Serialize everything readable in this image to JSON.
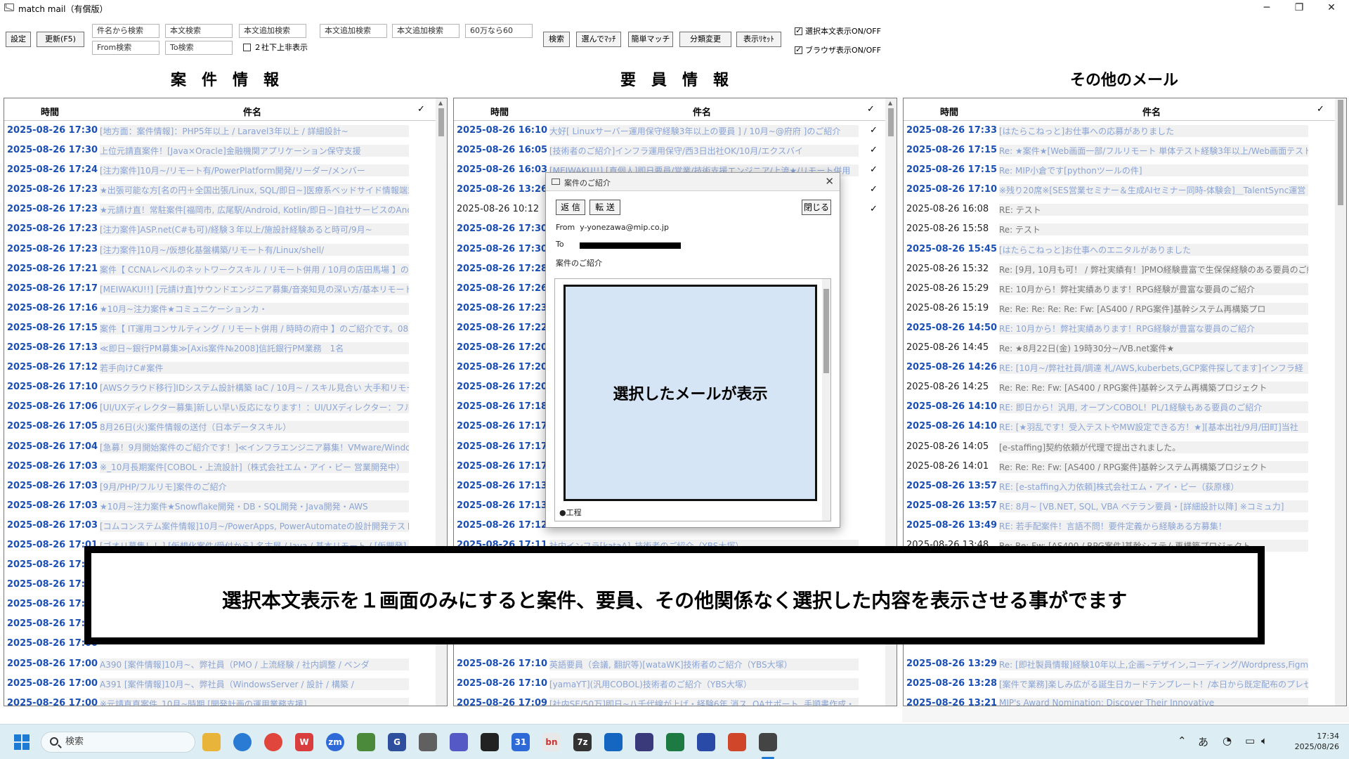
{
  "window": {
    "title": "match mail（有償版）"
  },
  "toolbar": {
    "settings": "設定",
    "refresh": "更新(F5)",
    "subject_search": "件名から検索",
    "from_search": "From検索",
    "body_search": "本文検索",
    "to_search": "To検索",
    "body_add_search_1": "本文追加検索",
    "body_add_search_2": "本文追加検索",
    "body_add_search_3": "本文追加検索",
    "amount_field": "60万なら60",
    "below2_label": "２社下上非表示",
    "search_btn": "検索",
    "pick_match": "選んでﾏｯﾁ",
    "easy_match": "簡単マッチ",
    "classify_change": "分類変更",
    "display_reset": "表示ﾘｾｯﾄ",
    "body_display_toggle": "選択本文表示ON/OFF",
    "browser_display_toggle": "ブラウザ表示ON/OFF"
  },
  "headings": {
    "projects": "案　件　情　報",
    "personnel": "要　員　情　報",
    "other": "その他のメール"
  },
  "columns": {
    "time": "時間",
    "subject": "件名",
    "check": "✓"
  },
  "panels": {
    "projects": [
      {
        "time": "2025-08-26 17:30",
        "subject": "[地方面：案件情報]：PHP5年以上 / Laravel3年以上 / 詳細設計~",
        "read": false,
        "check": ""
      },
      {
        "time": "2025-08-26 17:30",
        "subject": "上位元請直案件！[Java×Oracle]金融機関アプリケーション保守支援",
        "read": false,
        "check": ""
      },
      {
        "time": "2025-08-26 17:24",
        "subject": "[注力案件]10月~/リモート有/PowerPlatform開発/リーダー/メンバー",
        "read": false,
        "check": ""
      },
      {
        "time": "2025-08-26 17:23",
        "subject": "★出張可能な方[名の円＋全国出張/Linux, SQL/即日~]医療系ベッドサイド情報端末",
        "read": false,
        "check": ""
      },
      {
        "time": "2025-08-26 17:23",
        "subject": "★元請け直！常駐案件[福岡市, 広尾駅/Android, Kotlin/即日~]自社サービスのAndroid",
        "read": false,
        "check": ""
      },
      {
        "time": "2025-08-26 17:23",
        "subject": "[注力案件]ASP.net(C#も可)/経験３年以上/施設計経験あると時可/9月~",
        "read": false,
        "check": ""
      },
      {
        "time": "2025-08-26 17:23",
        "subject": "[注力案件]10月~/仮想化基盤構築/リモート有/Linux/shell/",
        "read": false,
        "check": ""
      },
      {
        "time": "2025-08-26 17:21",
        "subject": "案件【 CCNAレベルのネットワークスキル / リモート併用 / 10月の店田馬場 】のご紹介",
        "read": false,
        "check": ""
      },
      {
        "time": "2025-08-26 17:17",
        "subject": "[MEIWAKU!!] [元請け直]サウンドエンジニア募集/音楽知見の深い方/基本リモート (",
        "read": false,
        "check": ""
      },
      {
        "time": "2025-08-26 17:16",
        "subject": "★10月~注力案件★コミュニケーションカ・",
        "read": false,
        "check": ""
      },
      {
        "time": "2025-08-26 17:15",
        "subject": "案件【 IT運用コンサルティング / リモート併用 / 時時の府中 】のご紹介です。0826",
        "read": false,
        "check": ""
      },
      {
        "time": "2025-08-26 17:13",
        "subject": "≪即日~銀行PM募集≫[Axis案件№2008]信託銀行PM業務　1名",
        "read": false,
        "check": ""
      },
      {
        "time": "2025-08-26 17:12",
        "subject": "若手向けC#案件",
        "read": false,
        "check": ""
      },
      {
        "time": "2025-08-26 17:10",
        "subject": "[AWSクラウド移行]IDシステム設計構築 IaC / 10月~ / スキル見合い 大手和リモート",
        "read": false,
        "check": ""
      },
      {
        "time": "2025-08-26 17:06",
        "subject": "[UI/UXディレクター募集]新しい早い反応になります！：UI/UXディレクター：フルリモート",
        "read": false,
        "check": ""
      },
      {
        "time": "2025-08-26 17:05",
        "subject": "8月26日(火)案件情報の送付（日本データスキル）",
        "read": false,
        "check": ""
      },
      {
        "time": "2025-08-26 17:04",
        "subject": "[急募！9月開始案件のご紹介です！]≪インフラエンジニア募集！VMware/Windows",
        "read": false,
        "check": ""
      },
      {
        "time": "2025-08-26 17:03",
        "subject": "※_10月長期案件[COBOL・上流設計]（株式会社エム・アイ・ピー 営業開発中）",
        "read": false,
        "check": ""
      },
      {
        "time": "2025-08-26 17:03",
        "subject": "[9月/PHP/フルリモ]案件のご紹介",
        "read": false,
        "check": ""
      },
      {
        "time": "2025-08-26 17:03",
        "subject": "★10月~注力案件★Snowflake開発・DB・SQL開発・Java開発・AWS",
        "read": false,
        "check": ""
      },
      {
        "time": "2025-08-26 17:03",
        "subject": "[コムコンステム案件情報]10月~/PowerApps, PowerAutomateの設計開発テスト",
        "read": false,
        "check": ""
      },
      {
        "time": "2025-08-26 17:01",
        "subject": "[ゴオリ募集！！] [仮想化案件/受付から] 名古屋 / Java / 基本リモート / [仮開発]",
        "read": false,
        "check": ""
      },
      {
        "time": "2025-08-26 17:00",
        "subject": "",
        "read": false,
        "check": ""
      },
      {
        "time": "2025-08-26 17:00",
        "subject": "",
        "read": false,
        "check": ""
      },
      {
        "time": "2025-08-26 17:00",
        "subject": "",
        "read": false,
        "check": ""
      },
      {
        "time": "2025-08-26 17:00",
        "subject": "",
        "read": false,
        "check": ""
      },
      {
        "time": "2025-08-26 17:00",
        "subject": "",
        "read": false,
        "check": ""
      },
      {
        "time": "2025-08-26 17:00",
        "subject": "A390 [案件情報]10月~、弊社員（PMO / 上流経験 / 社内調整 / ベンダ",
        "read": false,
        "check": ""
      },
      {
        "time": "2025-08-26 17:00",
        "subject": "A391 [案件情報]10月~、弊社員（WindowsServer / 設計 / 構築 /",
        "read": false,
        "check": ""
      },
      {
        "time": "2025-08-26 17:00",
        "subject": "※元請直直案件_10月~時期 [開発計画の運用業務支援]",
        "read": false,
        "check": ""
      }
    ],
    "personnel": [
      {
        "time": "2025-08-26 16:10",
        "subject": "大好[ Linuxサーバー運用保守経験3年以上の要員 ] / 10月~@府府 ]のご紹介",
        "read": false,
        "check": "✓"
      },
      {
        "time": "2025-08-26 16:05",
        "subject": "[技術者のご紹介]インフラ運用保守/西3日出社OK/10月/エクスバイ",
        "read": false,
        "check": "✓"
      },
      {
        "time": "2025-08-26 16:03",
        "subject": "[MEIWAKU!!] [直個人]即日要員/営業/技術支援エンジニア/上流★/リモート併用",
        "read": false,
        "check": "✓"
      },
      {
        "time": "2025-08-26 13:26",
        "subject": "",
        "read": false,
        "check": "✓"
      },
      {
        "time": "2025-08-26 10:12",
        "subject": "",
        "read": true,
        "check": "✓"
      },
      {
        "time": "2025-08-26 17:30",
        "subject": "",
        "read": false,
        "check": ""
      },
      {
        "time": "2025-08-26 17:30",
        "subject": "",
        "read": false,
        "check": ""
      },
      {
        "time": "2025-08-26 17:28",
        "subject": "",
        "read": false,
        "check": ""
      },
      {
        "time": "2025-08-26 17:26",
        "subject": "",
        "read": false,
        "check": ""
      },
      {
        "time": "2025-08-26 17:23",
        "subject": "",
        "read": false,
        "check": ""
      },
      {
        "time": "2025-08-26 17:22",
        "subject": "",
        "read": false,
        "check": ""
      },
      {
        "time": "2025-08-26 17:20",
        "subject": "",
        "read": false,
        "check": ""
      },
      {
        "time": "2025-08-26 17:20",
        "subject": "",
        "read": false,
        "check": ""
      },
      {
        "time": "2025-08-26 17:20",
        "subject": "",
        "read": false,
        "check": ""
      },
      {
        "time": "2025-08-26 17:18",
        "subject": "",
        "read": false,
        "check": ""
      },
      {
        "time": "2025-08-26 17:17",
        "subject": "",
        "read": false,
        "check": ""
      },
      {
        "time": "2025-08-26 17:17",
        "subject": "",
        "read": false,
        "check": ""
      },
      {
        "time": "2025-08-26 17:17",
        "subject": "",
        "read": false,
        "check": ""
      },
      {
        "time": "2025-08-26 17:13",
        "subject": "",
        "read": false,
        "check": ""
      },
      {
        "time": "2025-08-26 17:13",
        "subject": "",
        "read": false,
        "check": ""
      },
      {
        "time": "2025-08-26 17:12",
        "subject": "",
        "read": false,
        "check": ""
      },
      {
        "time": "2025-08-26 17:11",
        "subject": "社内インフラ[kataA]_技術者のご紹介（YBS大塚）",
        "read": false,
        "check": ""
      },
      {
        "time": "",
        "subject": "",
        "read": false,
        "check": ""
      },
      {
        "time": "",
        "subject": "",
        "read": false,
        "check": ""
      },
      {
        "time": "",
        "subject": "",
        "read": false,
        "check": ""
      },
      {
        "time": "",
        "subject": "",
        "read": false,
        "check": ""
      },
      {
        "time": "",
        "subject": "",
        "read": false,
        "check": ""
      },
      {
        "time": "2025-08-26 17:10",
        "subject": "英語要員（会議, 翻訳等)[wataWK]技術者のご紹介（YBS大塚）",
        "read": false,
        "check": ""
      },
      {
        "time": "2025-08-26 17:10",
        "subject": "[yamaYT](汎用COBOL)技術者のご紹介（YBS大塚）",
        "read": false,
        "check": ""
      },
      {
        "time": "2025-08-26 17:09",
        "subject": "[社内SE/50万]即日~八千代線が上げ・経験6年 消ス, OAサポート, 手順書作成・",
        "read": false,
        "check": ""
      }
    ],
    "other": [
      {
        "time": "2025-08-26 17:33",
        "subject": "[はたらこねっと]お仕事への応募がありました",
        "read": false,
        "check": ""
      },
      {
        "time": "2025-08-26 17:15",
        "subject": "Re: ★案件★[Web画面一部/フルリモート 単体テスト経験3年以上/Web画面テスト経",
        "read": false,
        "check": ""
      },
      {
        "time": "2025-08-26 17:15",
        "subject": "Re: MIP小倉です[pythonツールの件]",
        "read": false,
        "check": ""
      },
      {
        "time": "2025-08-26 17:10",
        "subject": "※残り20席※[SES営業セミナー＆生成AIセミナー同時-体験会]＿TalentSync運営",
        "read": false,
        "check": ""
      },
      {
        "time": "2025-08-26 16:08",
        "subject": "RE: テスト",
        "read": true,
        "check": ""
      },
      {
        "time": "2025-08-26 15:58",
        "subject": "Re: テスト",
        "read": true,
        "check": ""
      },
      {
        "time": "2025-08-26 15:45",
        "subject": "[はたらこねっと]お仕事へのエニタルがありました",
        "read": false,
        "check": ""
      },
      {
        "time": "2025-08-26 15:32",
        "subject": "Re: [9月, 10月も可！ / 弊社実績有！]PMO経験豊富で生保保経験のある要員のご紹介",
        "read": true,
        "check": ""
      },
      {
        "time": "2025-08-26 15:29",
        "subject": "RE: 10月から！弊社実績あります！RPG経験が豊富な要員のご紹介",
        "read": true,
        "check": ""
      },
      {
        "time": "2025-08-26 15:19",
        "subject": "Re: Re: Re: Re: Re: Fw: [AS400 / RPG案件]基幹システム再構築プロ",
        "read": true,
        "check": ""
      },
      {
        "time": "2025-08-26 14:50",
        "subject": "RE: 10月から！弊社実績あります！RPG経験が豊富な要員のご紹介",
        "read": false,
        "check": ""
      },
      {
        "time": "2025-08-26 14:45",
        "subject": "Re: ★8月22日(金) 19時30分~/VB.net案件★",
        "read": true,
        "check": ""
      },
      {
        "time": "2025-08-26 14:26",
        "subject": "RE: [10月~/弊社社員/調達 札/AWS,kuberbets,GCP案件探してます]インフラ経",
        "read": false,
        "check": ""
      },
      {
        "time": "2025-08-26 14:25",
        "subject": "Re: Re: Re: Fw: [AS400 / RPG案件]基幹システム再構築プロジェクト",
        "read": true,
        "check": ""
      },
      {
        "time": "2025-08-26 14:10",
        "subject": "RE: 即日から！汎用, オープンCOBOL！PL/1経験もある要員のご紹介",
        "read": false,
        "check": ""
      },
      {
        "time": "2025-08-26 14:10",
        "subject": "RE: [★羽乱です！受入テストやMW設定できる方！★][基本出社/9月/田町]当社",
        "read": false,
        "check": ""
      },
      {
        "time": "2025-08-26 14:05",
        "subject": "[e-staffing]契約依頼が代理で提出されました。",
        "read": true,
        "check": ""
      },
      {
        "time": "2025-08-26 14:01",
        "subject": "Re: Re: Re: Fw: [AS400 / RPG案件]基幹システム再構築プロジェクト",
        "read": true,
        "check": ""
      },
      {
        "time": "2025-08-26 13:57",
        "subject": "RE: [e-staffing入力依頼]株式会社エム・アイ・ピー（荻原様）",
        "read": false,
        "check": ""
      },
      {
        "time": "2025-08-26 13:57",
        "subject": "RE: 8月~ [VB.NET, SQL, VBA ベテラン要員・[詳細設計以降] ※コミュ力]",
        "read": false,
        "check": ""
      },
      {
        "time": "2025-08-26 13:49",
        "subject": "RE: 若手配案件！言語不問！要件定義から経験ある方募集！",
        "read": false,
        "check": ""
      },
      {
        "time": "2025-08-26 13:48",
        "subject": "Re: Re: Fw: [AS400 / RPG案件]基幹システム再構築プロジェクト",
        "read": true,
        "check": ""
      },
      {
        "time": "",
        "subject": "",
        "read": false,
        "check": ""
      },
      {
        "time": "",
        "subject": "",
        "read": false,
        "check": ""
      },
      {
        "time": "",
        "subject": "",
        "read": false,
        "check": ""
      },
      {
        "time": "",
        "subject": "",
        "read": false,
        "check": ""
      },
      {
        "time": "",
        "subject": "",
        "read": false,
        "check": ""
      },
      {
        "time": "2025-08-26 13:29",
        "subject": "Re: [即社製員情報]経験10年以上,企画~デザイン,コーディング/Wordpress,Figma",
        "read": false,
        "check": ""
      },
      {
        "time": "2025-08-26 13:28",
        "subject": "[案件で業務]楽しみ広がる誕生日カードテンプレート！/本日から既定配布のプレゼント素材",
        "read": false,
        "check": ""
      },
      {
        "time": "2025-08-26 13:21",
        "subject": "MIP's Award Nomination: Discover Their Innovative",
        "read": false,
        "check": ""
      }
    ]
  },
  "popup": {
    "title": "案件のご紹介",
    "reply": "返 信",
    "forward": "転 送",
    "close": "閉じる",
    "from_label": "From",
    "from_value": "y-yonezawa@mip.co.jp",
    "to_label": "To",
    "subject": "案件のご紹介",
    "body_last_line": "●工程",
    "preview_text": "選択したメールが表示"
  },
  "callout": {
    "text": "選択本文表示を１画面のみにすると案件、要員、その他関係なく選択した内容を表示させる事がでます"
  },
  "taskbar": {
    "search_placeholder": "検索",
    "ime": "あ",
    "time": "17:34",
    "date": "2025/08/26"
  }
}
